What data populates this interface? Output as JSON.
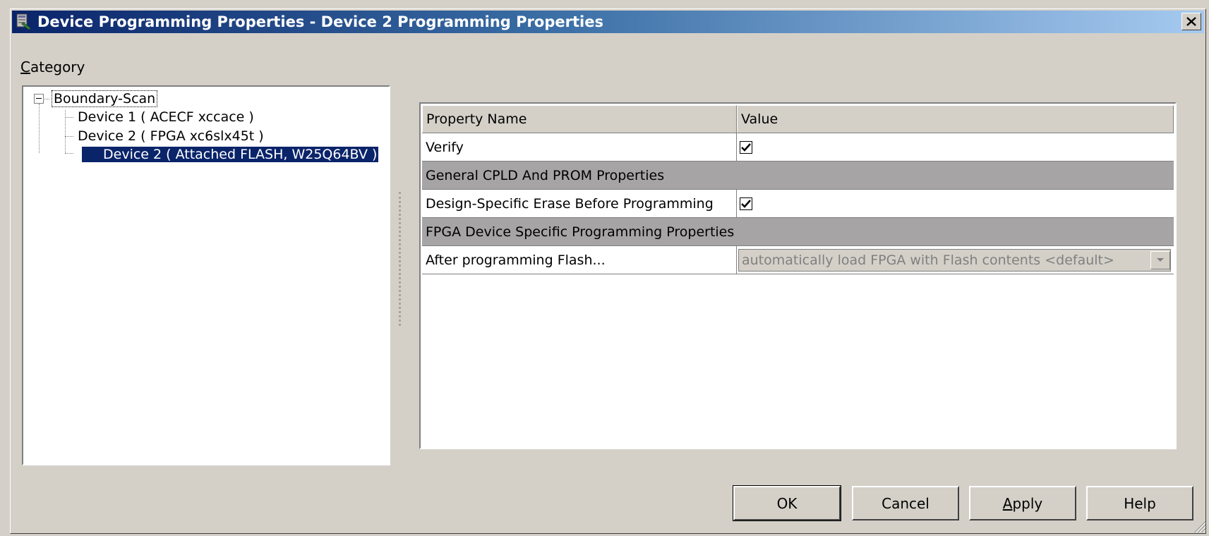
{
  "window": {
    "title": "Device Programming Properties - Device 2 Programming Properties",
    "close_label": "X"
  },
  "category": {
    "label_accel": "C",
    "label_rest": "ategory"
  },
  "tree": {
    "root": "Boundary-Scan",
    "items": [
      {
        "label": "Device 1 ( ACECF xccace )"
      },
      {
        "label": "Device 2 ( FPGA xc6slx45t )"
      },
      {
        "label": "Device 2 ( Attached FLASH, W25Q64BV )",
        "selected": true
      }
    ]
  },
  "grid": {
    "columns": [
      "Property Name",
      "Value"
    ],
    "rows": [
      {
        "name": "Verify",
        "type": "checkbox",
        "checked": true
      },
      {
        "name": "General CPLD And PROM Properties",
        "type": "section"
      },
      {
        "name": "Design-Specific Erase Before Programming",
        "type": "checkbox",
        "checked": true
      },
      {
        "name": "FPGA Device Specific Programming Properties",
        "type": "section"
      },
      {
        "name": "After programming Flash...",
        "type": "combo",
        "value": "automatically load FPGA with Flash contents <default>"
      }
    ]
  },
  "buttons": {
    "ok": "OK",
    "cancel": "Cancel",
    "apply_accel": "A",
    "apply_rest": "pply",
    "help": "Help"
  },
  "colors": {
    "title_start": "#0a246a",
    "title_end": "#a6caf0",
    "selection": "#0a246a",
    "section_bg": "#a6a4a4",
    "dialog_bg": "#d4d0c8"
  }
}
